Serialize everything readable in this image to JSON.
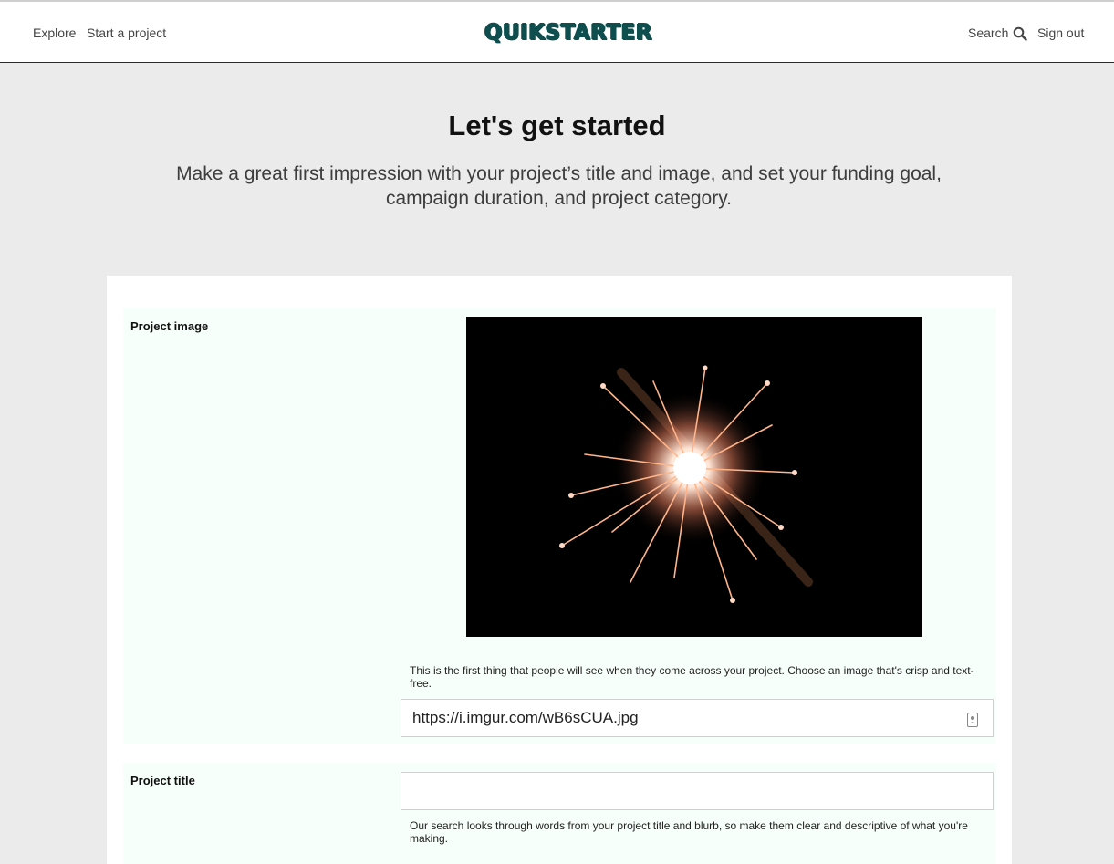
{
  "nav": {
    "explore": "Explore",
    "start_project": "Start a project",
    "logo": "QUIKSTARTER",
    "search": "Search",
    "sign_out": "Sign out"
  },
  "hero": {
    "title": "Let's get started",
    "subtitle": "Make a great first impression with your project’s title and image, and set your funding goal, campaign duration, and project category."
  },
  "form": {
    "project_image": {
      "label": "Project image",
      "help": "This is the first thing that people will see when they come across your project. Choose an image that's crisp and text-free.",
      "value": "https://i.imgur.com/wB6sCUA.jpg"
    },
    "project_title": {
      "label": "Project title",
      "value": "",
      "help": "Our search looks through words from your project title and blurb, so make them clear and descriptive of what you're making."
    }
  },
  "icons": {
    "search": "search-icon",
    "contact_card": "contact-card-icon"
  },
  "colors": {
    "logo": "#0f4e4e",
    "page_background": "#ebebeb",
    "form_row_background": "#f7fffb"
  }
}
